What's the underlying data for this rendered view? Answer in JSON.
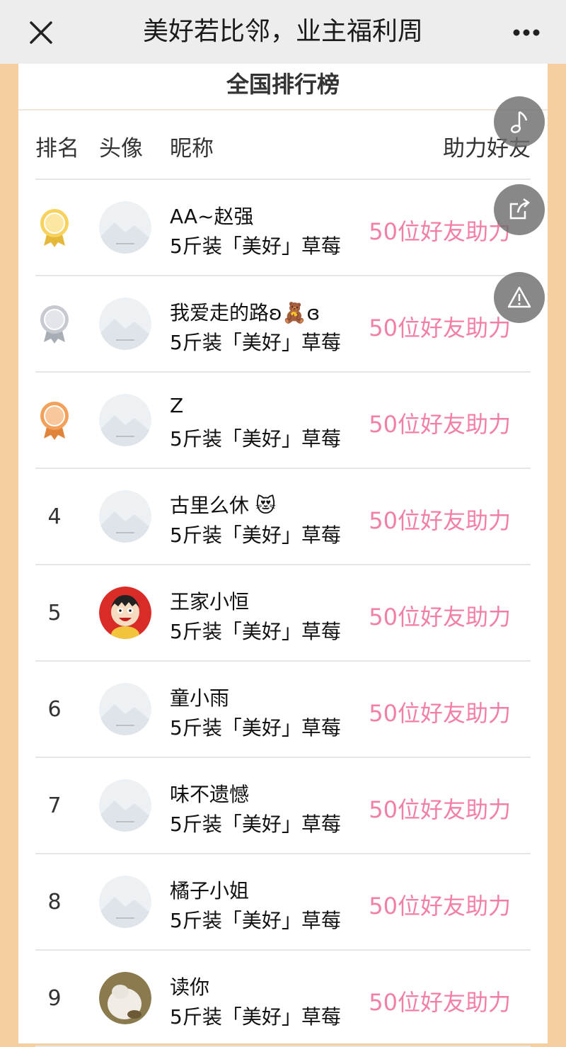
{
  "topbar": {
    "title": "美好若比邻，业主福利周"
  },
  "panel": {
    "title": "全国排行榜"
  },
  "columns": {
    "rank": "排名",
    "avatar": "头像",
    "nickname": "昵称",
    "helpers": "助力好友"
  },
  "rows": [
    {
      "rank": "1",
      "medal": "gold",
      "avatar": "placeholder",
      "nickname": "AA~赵强",
      "prize": "5斤装「美好」草莓",
      "helpers": "50位好友助力"
    },
    {
      "rank": "2",
      "medal": "silver",
      "avatar": "placeholder",
      "nickname": "我爱走的路ʚ🧸ɞ",
      "prize": "5斤装「美好」草莓",
      "helpers": "50位好友助力"
    },
    {
      "rank": "3",
      "medal": "bronze",
      "avatar": "placeholder",
      "nickname": "Z",
      "prize": "5斤装「美好」草莓",
      "helpers": "50位好友助力"
    },
    {
      "rank": "4",
      "medal": "",
      "avatar": "placeholder",
      "nickname": "古里么休 😻",
      "prize": "5斤装「美好」草莓",
      "helpers": "50位好友助力"
    },
    {
      "rank": "5",
      "medal": "",
      "avatar": "cartoon-boy",
      "nickname": "王家小恒",
      "prize": "5斤装「美好」草莓",
      "helpers": "50位好友助力"
    },
    {
      "rank": "6",
      "medal": "",
      "avatar": "placeholder",
      "nickname": "童小雨",
      "prize": "5斤装「美好」草莓",
      "helpers": "50位好友助力"
    },
    {
      "rank": "7",
      "medal": "",
      "avatar": "placeholder",
      "nickname": "味不遗憾",
      "prize": "5斤装「美好」草莓",
      "helpers": "50位好友助力"
    },
    {
      "rank": "8",
      "medal": "",
      "avatar": "placeholder",
      "nickname": "橘子小姐",
      "prize": "5斤装「美好」草莓",
      "helpers": "50位好友助力"
    },
    {
      "rank": "9",
      "medal": "",
      "avatar": "photo-cat",
      "nickname": "读你",
      "prize": "5斤装「美好」草莓",
      "helpers": "50位好友助力"
    }
  ],
  "icons": {
    "close": "close-icon",
    "more": "more-icon",
    "music": "music-note-icon",
    "share": "share-icon",
    "report": "warning-icon"
  },
  "colors": {
    "background": "#f6cfa0",
    "helpers_text": "#f27fa8",
    "gold": "#f7d25c",
    "silver": "#c6c9d0",
    "bronze": "#f3a05b"
  }
}
